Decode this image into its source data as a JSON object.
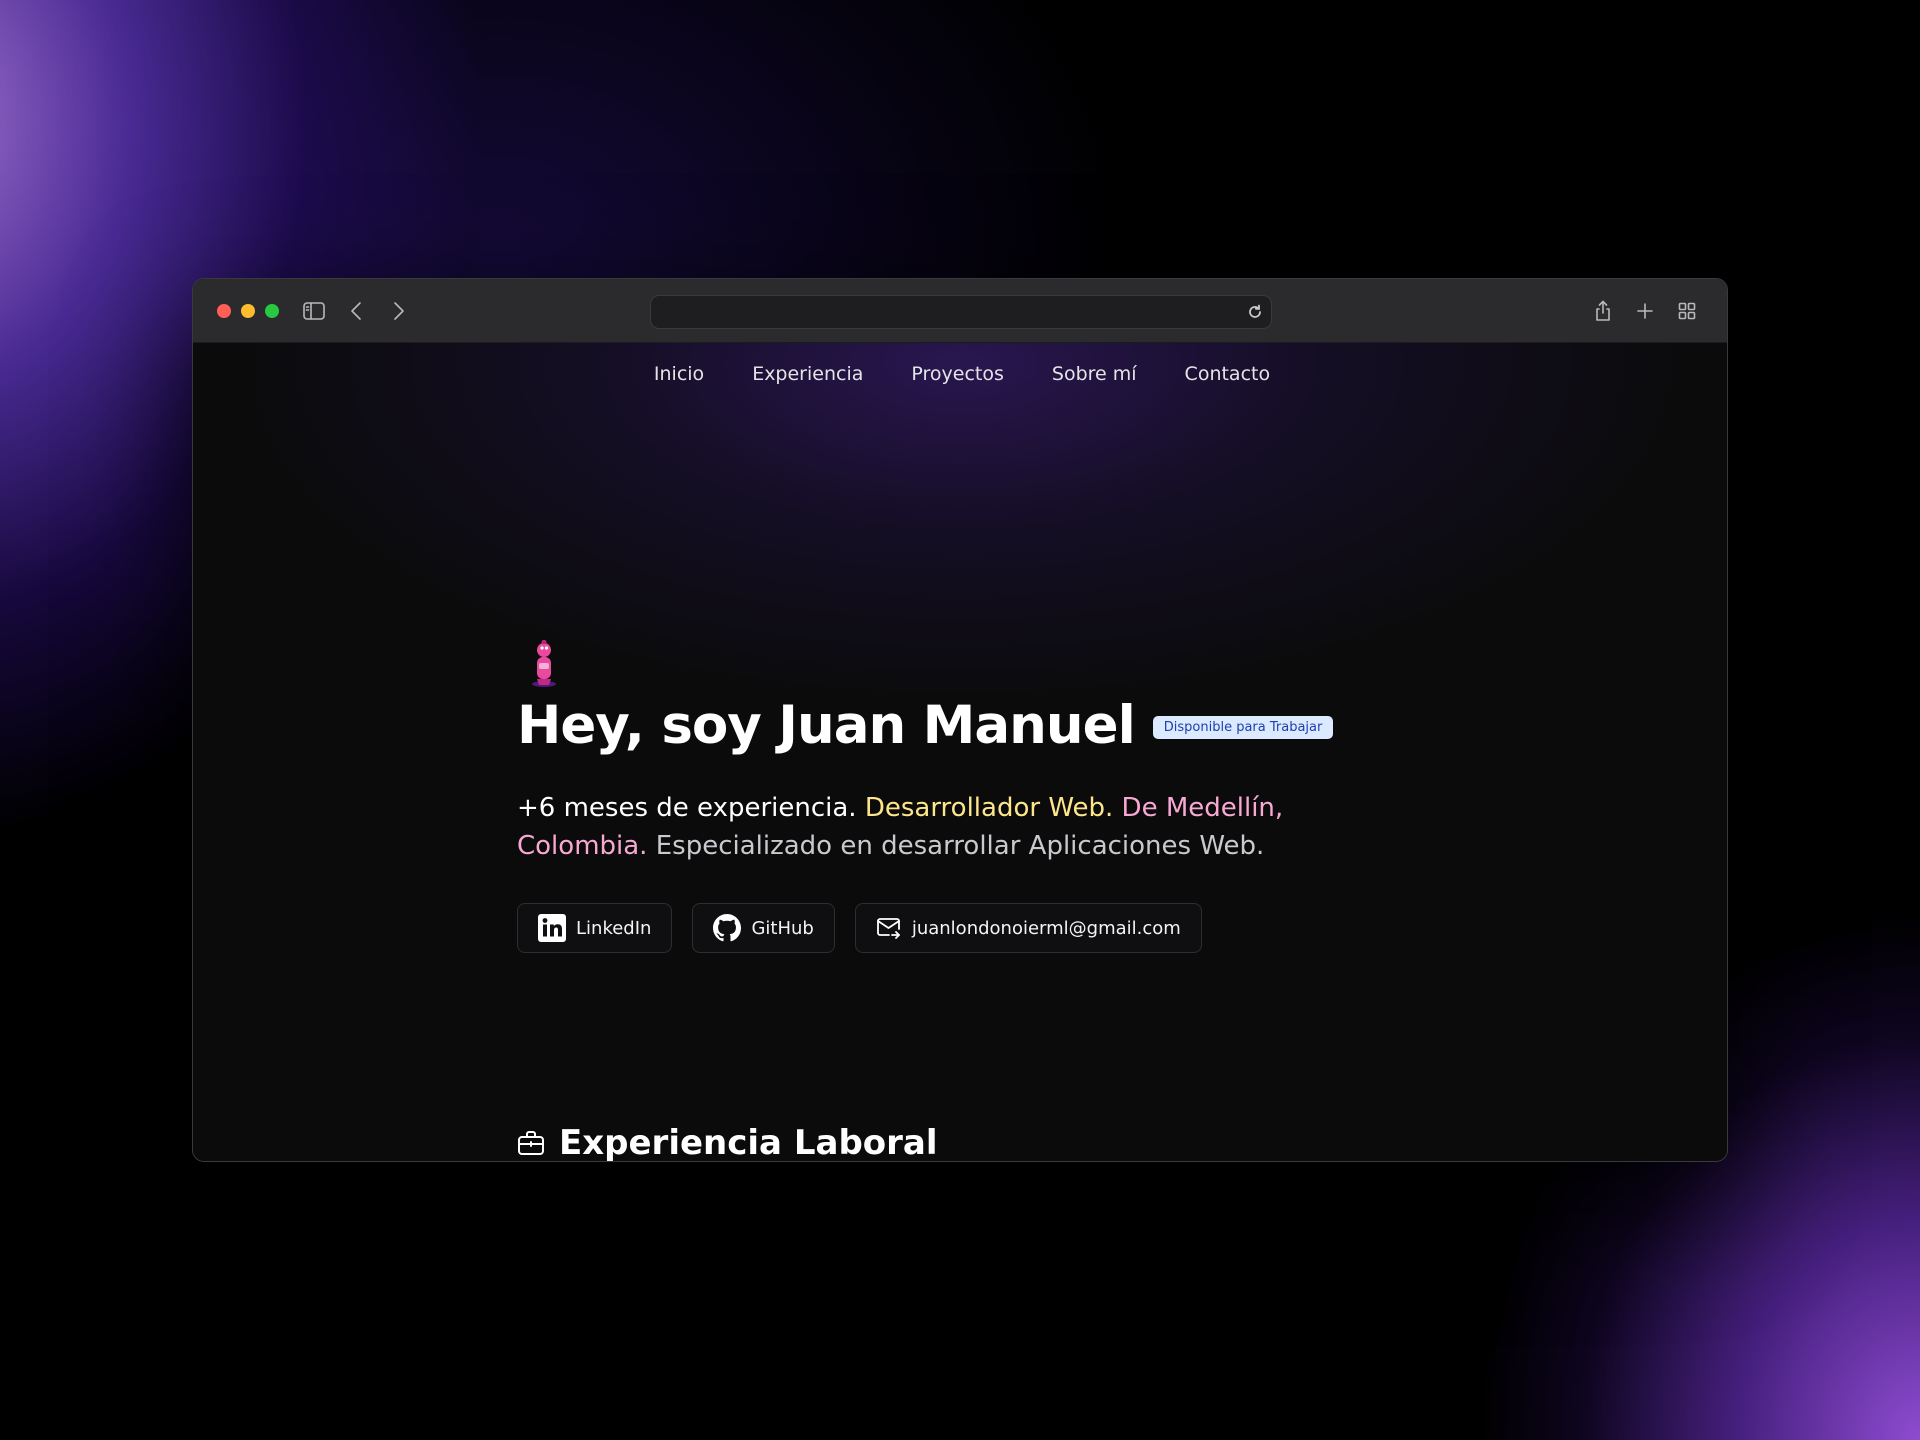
{
  "browser": {
    "address_value": "",
    "icons": [
      "sidebar-icon",
      "back-icon",
      "forward-icon",
      "reload-icon",
      "share-icon",
      "new-tab-icon",
      "tab-overview-icon"
    ]
  },
  "nav": {
    "items": [
      {
        "label": "Inicio"
      },
      {
        "label": "Experiencia"
      },
      {
        "label": "Proyectos"
      },
      {
        "label": "Sobre mí"
      },
      {
        "label": "Contacto"
      }
    ]
  },
  "hero": {
    "title": "Hey, soy Juan Manuel",
    "badge": "Disponible para Trabajar",
    "desc_part1": "+6 meses de experiencia.",
    "desc_part2": "Desarrollador Web.",
    "desc_part3": "De Medellín, Colombia.",
    "desc_part4": "Especializado en desarrollar Aplicaciones Web.",
    "links": [
      {
        "label": "LinkedIn",
        "icon": "linkedin-icon"
      },
      {
        "label": "GitHub",
        "icon": "github-icon"
      },
      {
        "label": "juanlondonoierml@gmail.com",
        "icon": "mail-icon"
      }
    ]
  },
  "section": {
    "title": "Experiencia Laboral",
    "icon": "briefcase-icon"
  },
  "colors": {
    "badge_bg": "#dbeafe",
    "badge_text": "#1e40af",
    "highlight_yellow": "#fde68a",
    "highlight_pink": "#f9a8d4"
  }
}
